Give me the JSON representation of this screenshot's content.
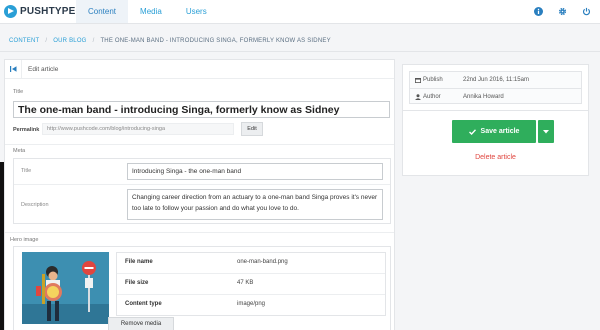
{
  "app": {
    "brand": "PUSHTYPE"
  },
  "nav": {
    "tabs": [
      {
        "label": "Content",
        "active": true
      },
      {
        "label": "Media",
        "active": false
      },
      {
        "label": "Users",
        "active": false
      }
    ],
    "icons": [
      "info-icon",
      "gear-icon",
      "power-icon"
    ]
  },
  "breadcrumb": {
    "items": [
      "CONTENT",
      "OUR BLOG",
      "THE ONE-MAN BAND - INTRODUCING SINGA, FORMERLY KNOW AS SIDNEY"
    ],
    "separator": "/"
  },
  "editor": {
    "header_label": "Edit article",
    "title_label": "Title",
    "title_value": "The one-man band - introducing Singa, formerly know as Sidney",
    "permalink_label": "Permalink",
    "permalink_value": "http://www.pushcode.com/blog/introducing-singa",
    "edit_button": "Edit"
  },
  "meta": {
    "section_label": "Meta",
    "title_key": "Title",
    "title_value": "Introducing Singa - the one-man band",
    "description_key": "Description",
    "description_value": "Changing career direction from an actuary to a one-man band Singa proves it's never too late to follow your passion and do what you love to do."
  },
  "hero": {
    "section_label": "Hero image",
    "file_table": [
      {
        "key": "File name",
        "value": "one-man-band.png"
      },
      {
        "key": "File size",
        "value": "47 KB"
      },
      {
        "key": "Content type",
        "value": "image/png"
      }
    ],
    "remove_button": "Remove media"
  },
  "sidebar": {
    "publish_key": "Publish",
    "publish_value": "22nd Jun 2016, 11:15am",
    "author_key": "Author",
    "author_value": "Annika Howard",
    "save_button": "Save article",
    "delete_link": "Delete article"
  },
  "colors": {
    "accent": "#2a9fd6",
    "save_green": "#2fae5c",
    "danger_red": "#e0463f"
  }
}
